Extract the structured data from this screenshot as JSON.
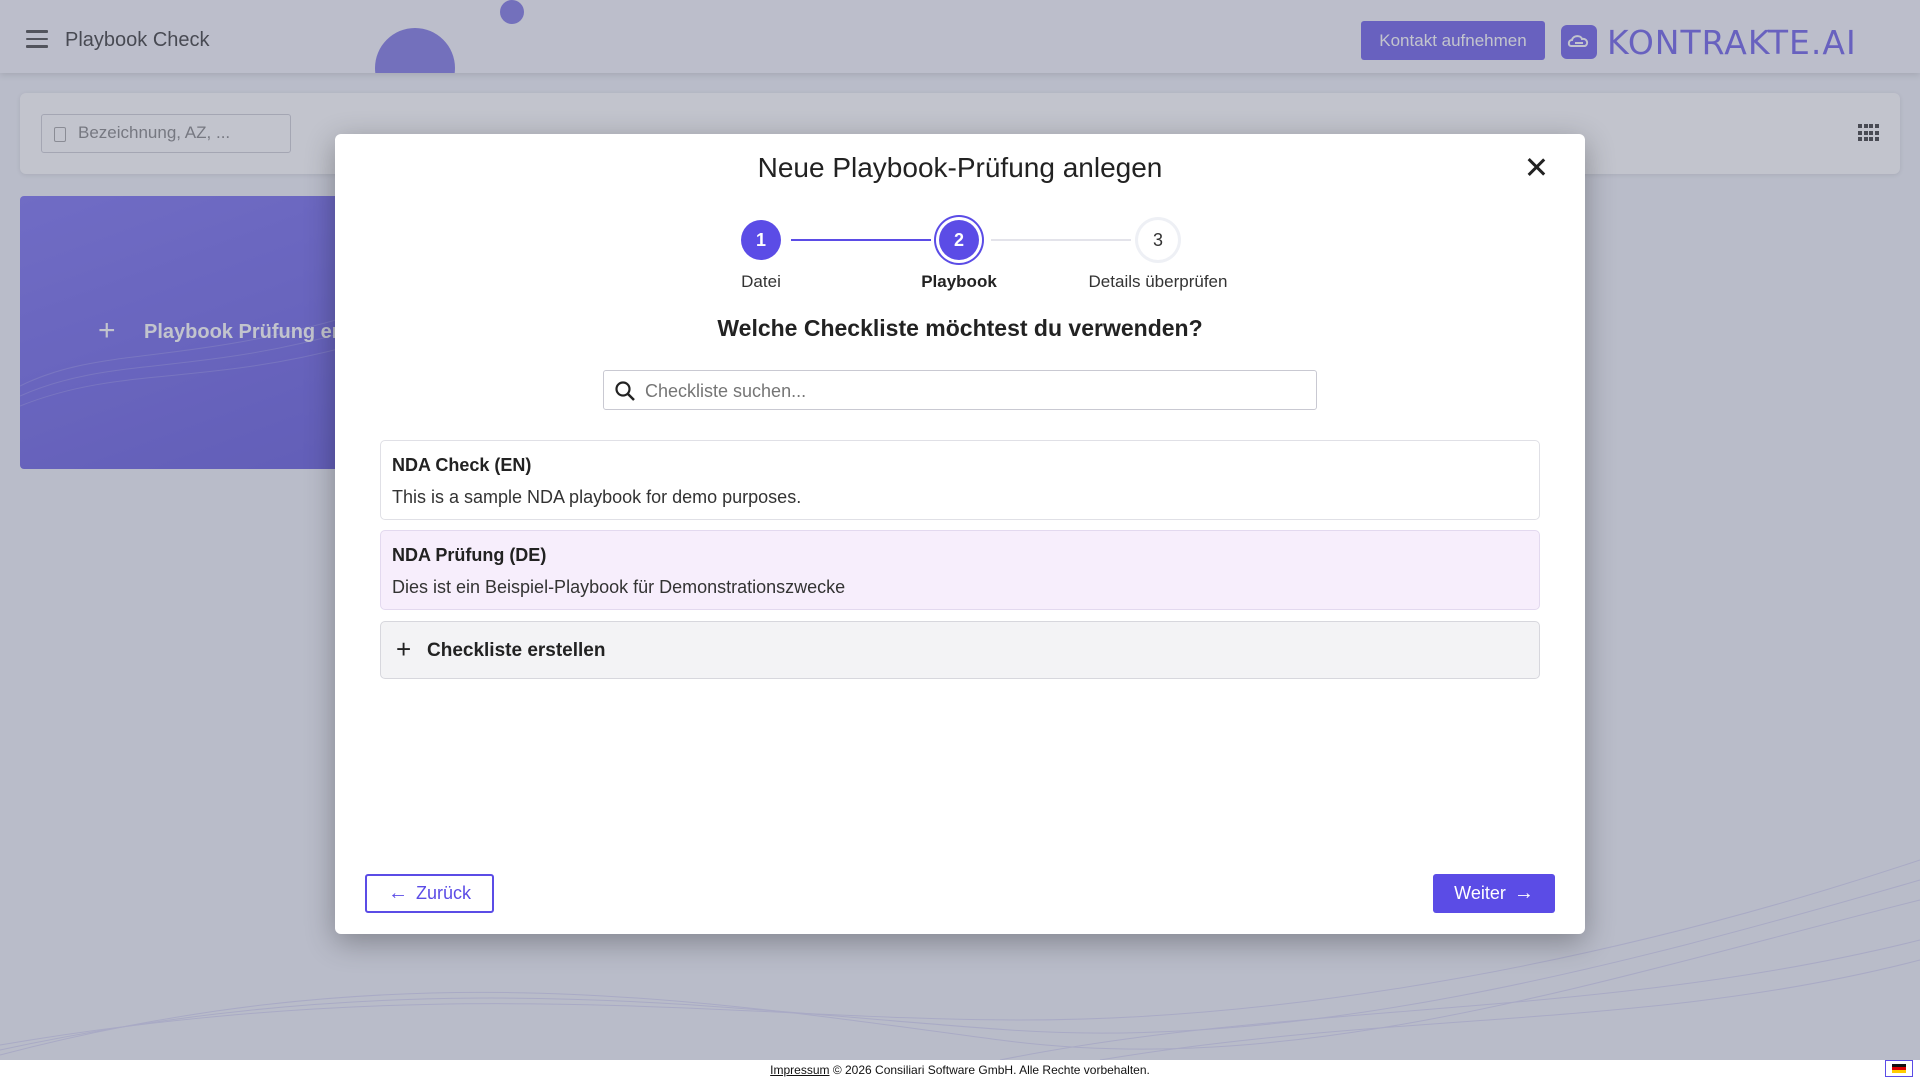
{
  "app": {
    "title": "Playbook Check",
    "contact_label": "Kontakt aufnehmen",
    "logo_text": "KONTRAKTE.AI"
  },
  "toolbar": {
    "search_placeholder": "Bezeichnung, AZ, ..."
  },
  "create_card": {
    "label": "Playbook Prüfung erstellen"
  },
  "modal": {
    "title": "Neue Playbook-Prüfung anlegen",
    "steps": [
      {
        "number": "1",
        "label": "Datei",
        "state": "done"
      },
      {
        "number": "2",
        "label": "Playbook",
        "state": "active"
      },
      {
        "number": "3",
        "label": "Details überprüfen",
        "state": "todo"
      }
    ],
    "question": "Welche Checkliste möchtest du verwenden?",
    "search_placeholder": "Checkliste suchen...",
    "checklists": [
      {
        "name": "NDA Check (EN)",
        "description": "This is a sample NDA playbook for demo purposes.",
        "selected": false
      },
      {
        "name": "NDA Prüfung (DE)",
        "description": "Dies ist ein Beispiel-Playbook für Demonstrationszwecke",
        "selected": true
      }
    ],
    "create_label": "Checkliste erstellen",
    "back_label": "Zurück",
    "next_label": "Weiter"
  },
  "footer": {
    "impressum": "Impressum",
    "copyright": " © 2026 Consiliari Software GmbH. Alle Rechte vorbehalten."
  },
  "colors": {
    "accent": "#5b4ce6",
    "selected_bg": "#f7eefc"
  }
}
